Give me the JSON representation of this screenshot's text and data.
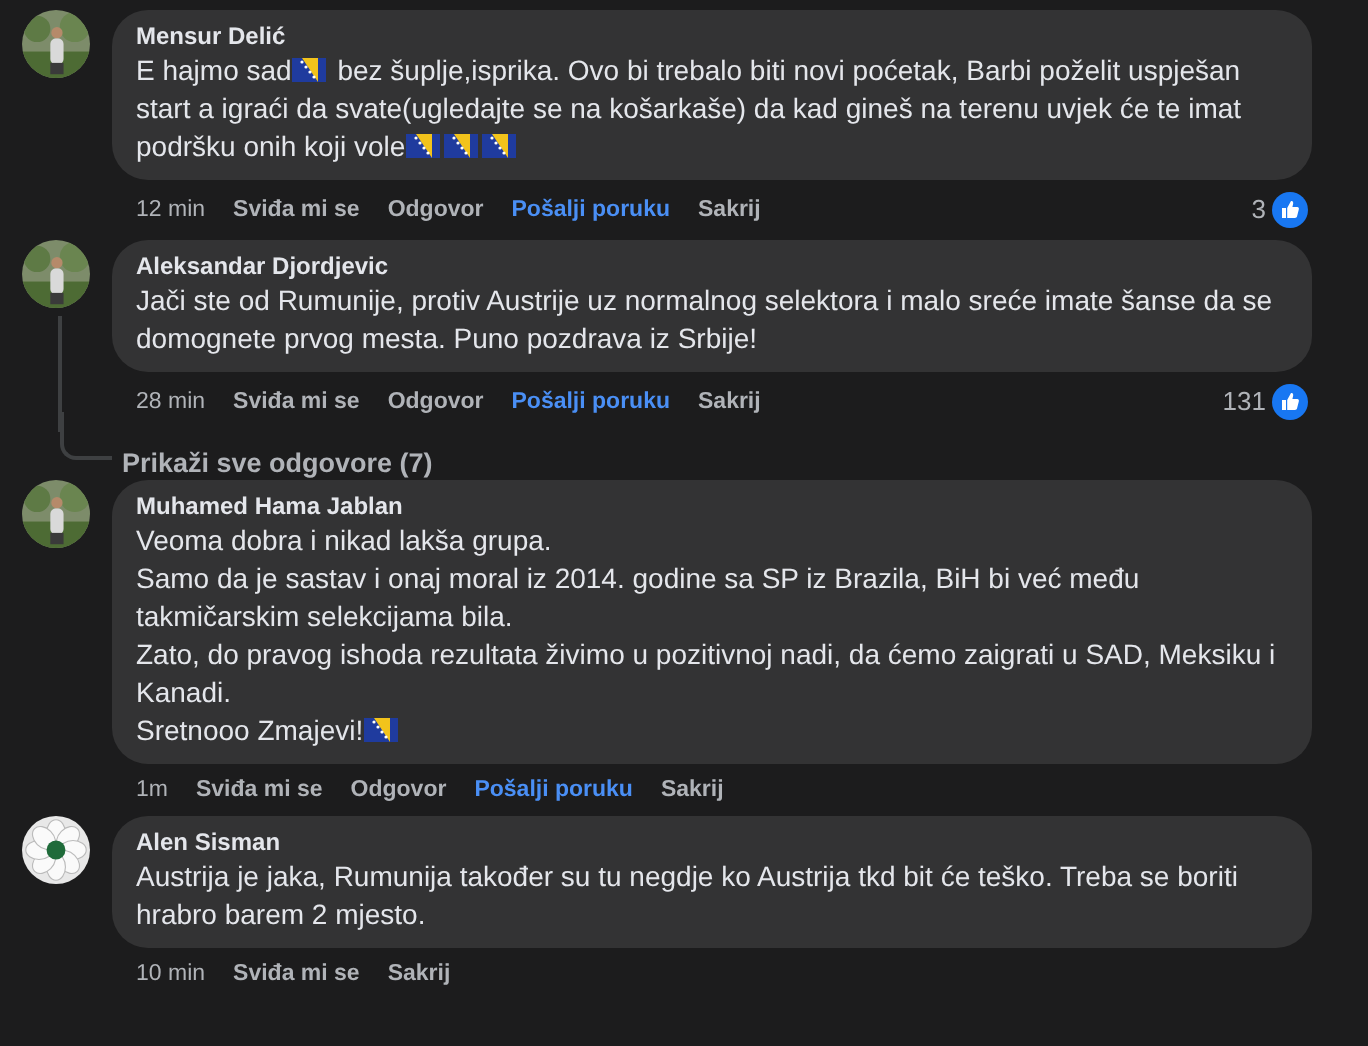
{
  "comments": [
    {
      "author": "Mensur Delić",
      "paragraphs": [
        [
          {
            "kind": "text",
            "text": "E hajmo sad"
          },
          {
            "kind": "flag"
          },
          {
            "kind": "text",
            "text": " bez šuplje,isprika. Ovo bi trebalo biti novi poćetak, Barbi poželit uspješan start a igraći da svate(ugledajte se na košarkaše) da kad gineš na terenu uvjek će te imat podršku onih koji vole"
          },
          {
            "kind": "flag"
          },
          {
            "kind": "flag"
          },
          {
            "kind": "flag"
          }
        ]
      ],
      "actions": [
        {
          "kind": "time",
          "label": "12 min"
        },
        {
          "kind": "action",
          "label": "Sviđa mi se"
        },
        {
          "kind": "action",
          "label": "Odgovor"
        },
        {
          "kind": "link",
          "label": "Pošalji poruku"
        },
        {
          "kind": "action",
          "label": "Sakrij"
        }
      ],
      "likes": "3"
    },
    {
      "author": "Aleksandar Djordjevic",
      "paragraphs": [
        [
          {
            "kind": "text",
            "text": "Jači ste od Rumunije, protiv Austrije uz normalnog selektora i malo sreće imate šanse da se domognete prvog mesta. Puno pozdrava iz Srbije!"
          }
        ]
      ],
      "actions": [
        {
          "kind": "time",
          "label": "28 min"
        },
        {
          "kind": "action",
          "label": "Sviđa mi se"
        },
        {
          "kind": "action",
          "label": "Odgovor"
        },
        {
          "kind": "link",
          "label": "Pošalji poruku"
        },
        {
          "kind": "action",
          "label": "Sakrij"
        }
      ],
      "likes": "131",
      "replies": "Prikaži sve odgovore (7)"
    },
    {
      "author": "Muhamed Hama Jablan",
      "paragraphs": [
        [
          {
            "kind": "text",
            "text": "Veoma dobra i nikad lakša grupa."
          }
        ],
        [
          {
            "kind": "text",
            "text": "Samo da je sastav i onaj moral iz 2014. godine sa SP iz Brazila, BiH bi već među takmičarskim selekcijama bila."
          }
        ],
        [
          {
            "kind": "text",
            "text": "Zato, do pravog ishoda rezultata živimo u pozitivnoj nadi, da ćemo zaigrati u SAD, Meksiku i Kanadi."
          }
        ],
        [
          {
            "kind": "text",
            "text": "Sretnooo Zmajevi!"
          },
          {
            "kind": "flag"
          }
        ]
      ],
      "actions": [
        {
          "kind": "time",
          "label": "1m"
        },
        {
          "kind": "action",
          "label": "Sviđa mi se"
        },
        {
          "kind": "action",
          "label": "Odgovor"
        },
        {
          "kind": "link",
          "label": "Pošalji poruku"
        },
        {
          "kind": "action",
          "label": "Sakrij"
        }
      ]
    },
    {
      "author": "Alen Sisman",
      "paragraphs": [
        [
          {
            "kind": "text",
            "text": "Austrija je jaka, Rumunija također su tu negdje ko Austrija tkd bit će teško. Treba se boriti hrabro barem 2 mjesto."
          }
        ]
      ],
      "actions": [
        {
          "kind": "time",
          "label": "10 min"
        },
        {
          "kind": "action",
          "label": "Sviđa mi se"
        },
        {
          "kind": "action",
          "label": "Sakrij"
        }
      ]
    }
  ]
}
